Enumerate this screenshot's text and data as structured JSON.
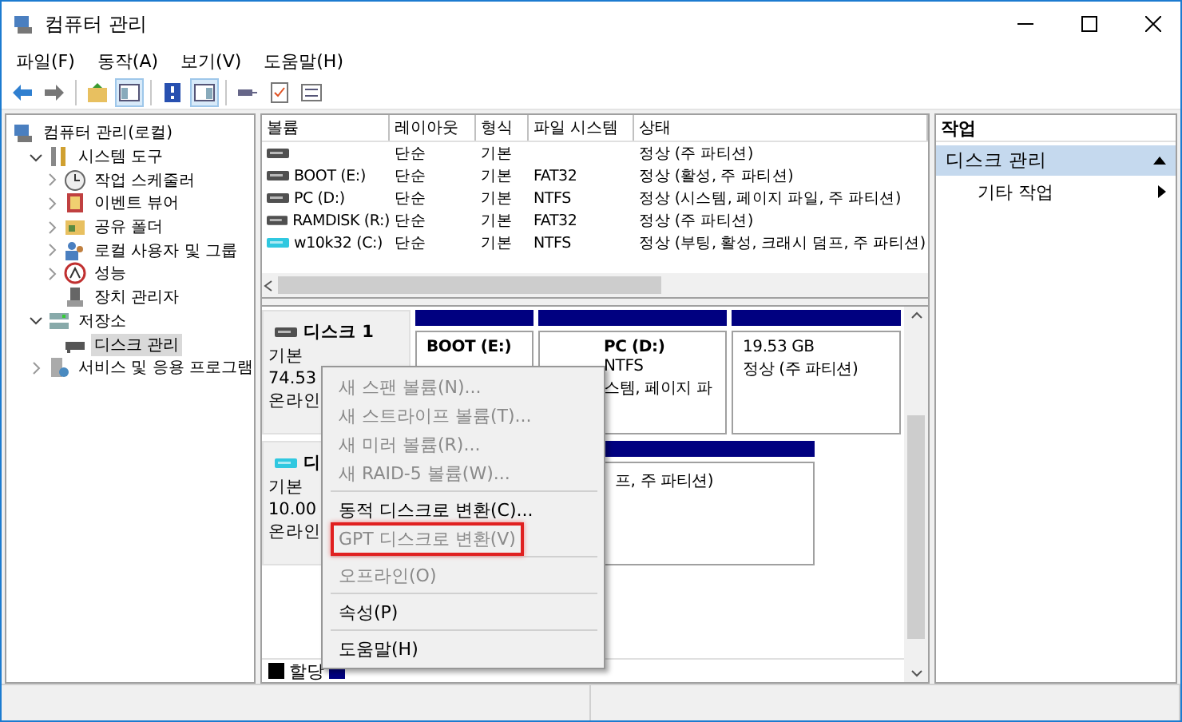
{
  "window": {
    "title": "컴퓨터 관리"
  },
  "menu": [
    "파일(F)",
    "동작(A)",
    "보기(V)",
    "도움말(H)"
  ],
  "toolbar": [
    {
      "pressed": false
    },
    {
      "pressed": false
    },
    {
      "pressed": false
    },
    {
      "pressed": true
    },
    {
      "pressed": false
    },
    {
      "pressed": true
    },
    {
      "pressed": false
    },
    {
      "pressed": false
    },
    {
      "pressed": false
    }
  ],
  "tree": [
    {
      "label": "컴퓨터 관리(로컬)",
      "kind": "root",
      "selected": false,
      "children": [
        {
          "label": "시스템 도구",
          "kind": "branch",
          "expanded": true,
          "selected": false,
          "children": [
            {
              "label": "작업 스케줄러",
              "kind": "branch",
              "expanded": false,
              "selected": false
            },
            {
              "label": "이벤트 뷰어",
              "kind": "branch",
              "expanded": false,
              "selected": false
            },
            {
              "label": "공유 폴더",
              "kind": "branch",
              "expanded": false,
              "selected": false
            },
            {
              "label": "로컬 사용자 및 그룹",
              "kind": "branch",
              "expanded": false,
              "selected": false
            },
            {
              "label": "성능",
              "kind": "branch",
              "expanded": false,
              "selected": false
            },
            {
              "label": "장치 관리자",
              "kind": "leaf",
              "selected": false
            }
          ]
        },
        {
          "label": "저장소",
          "kind": "branch",
          "expanded": true,
          "selected": false,
          "children": [
            {
              "label": "디스크 관리",
              "kind": "leaf",
              "selected": true
            }
          ]
        },
        {
          "label": "서비스 및 응용 프로그램",
          "kind": "branch",
          "expanded": false,
          "selected": false
        }
      ]
    }
  ],
  "volumes": {
    "columns": [
      "볼륨",
      "레이아웃",
      "형식",
      "파일 시스템",
      "상태"
    ],
    "rows": [
      {
        "layout": "단순",
        "type": "기본",
        "status": "정상 (주 파티션)",
        "color": "#505050"
      },
      {
        "volume": "BOOT (E:)",
        "layout": "단순",
        "type": "기본",
        "file_system": "FAT32",
        "status": "정상 (활성, 주 파티션)",
        "color": "#505050"
      },
      {
        "volume": "PC (D:)",
        "layout": "단순",
        "type": "기본",
        "file_system": "NTFS",
        "status": "정상 (시스템, 페이지 파일, 주 파티션)",
        "color": "#505050"
      },
      {
        "volume": "RAMDISK (R:)",
        "layout": "단순",
        "type": "기본",
        "file_system": "FAT32",
        "status": "정상 (주 파티션)",
        "color": "#505050"
      },
      {
        "volume": "w10k32 (C:)",
        "layout": "단순",
        "type": "기본",
        "file_system": "NTFS",
        "status": "정상 (부팅, 활성, 크래시 덤프, 주 파티션)",
        "color": "#30c8e0"
      }
    ]
  },
  "disks": [
    {
      "name": "디스크 1",
      "type": "기본",
      "size": "74.53",
      "state": "온라인",
      "color": "#505050",
      "partitions": [
        {
          "name": "BOOT  (E:)"
        },
        {
          "name": "PC  (D:)",
          "lines": [
            "NTFS",
            "스템, 페이지 파"
          ]
        },
        {
          "lines": [
            "19.53 GB",
            "정상 (주 파티션)"
          ]
        }
      ]
    },
    {
      "name": "디",
      "type": "기본",
      "size": "10.00",
      "state": "온라인",
      "color": "#30c8e0",
      "partitions": [
        {
          "lines": [
            "프, 주 파티션)"
          ]
        }
      ]
    }
  ],
  "legend": [
    {
      "label": "할당",
      "color": "#000000"
    },
    {
      "color": "#000080"
    }
  ],
  "actions": {
    "header": "작업",
    "section": {
      "label": "디스크 관리",
      "expanded": true
    },
    "items": [
      "기타 작업"
    ]
  },
  "context_menu": [
    {
      "kind": "item",
      "label": "새 스팬 볼륨(N)...",
      "disabled": true,
      "highlighted": false
    },
    {
      "kind": "item",
      "label": "새 스트라이프 볼륨(T)...",
      "disabled": true,
      "highlighted": false
    },
    {
      "kind": "item",
      "label": "새 미러 볼륨(R)...",
      "disabled": true,
      "highlighted": false
    },
    {
      "kind": "item",
      "label": "새 RAID-5 볼륨(W)...",
      "disabled": true,
      "highlighted": false
    },
    {
      "kind": "separator"
    },
    {
      "kind": "item",
      "label": "동적 디스크로 변환(C)...",
      "disabled": false,
      "highlighted": false
    },
    {
      "kind": "item",
      "label": "GPT 디스크로 변환(V)",
      "disabled": true,
      "highlighted": true
    },
    {
      "kind": "separator"
    },
    {
      "kind": "item",
      "label": "오프라인(O)",
      "disabled": true,
      "highlighted": false
    },
    {
      "kind": "separator"
    },
    {
      "kind": "item",
      "label": "속성(P)",
      "disabled": false,
      "highlighted": false
    },
    {
      "kind": "separator"
    },
    {
      "kind": "item",
      "label": "도움말(H)",
      "disabled": false,
      "highlighted": false
    }
  ]
}
